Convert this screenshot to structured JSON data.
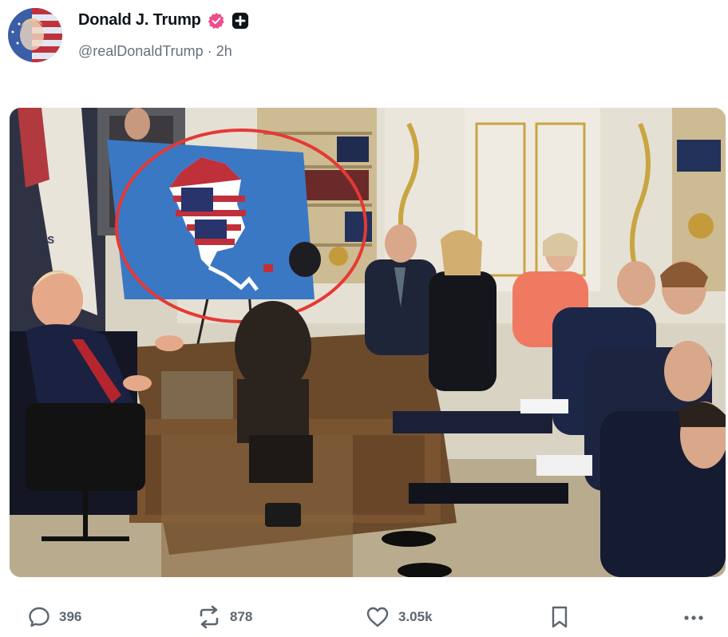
{
  "post": {
    "author_name": "Donald J. Trump",
    "handle": "@realDonaldTrump",
    "separator": "·",
    "time": "2h",
    "verified_badge_icon": "verified-badge-icon",
    "follow_icon": "plus-square-icon",
    "image": {
      "description_icon": "photo",
      "map_overlay": "us-flag-north-america-map",
      "highlight_color": "#e53935"
    }
  },
  "actions": {
    "replies": "396",
    "reposts": "878",
    "likes": "3.05k",
    "bookmark_icon": "bookmark-icon",
    "more_icon": "more-icon"
  },
  "colors": {
    "handle": "#65717d",
    "badge": "#ee4d8f",
    "action_text": "#5b6670"
  }
}
